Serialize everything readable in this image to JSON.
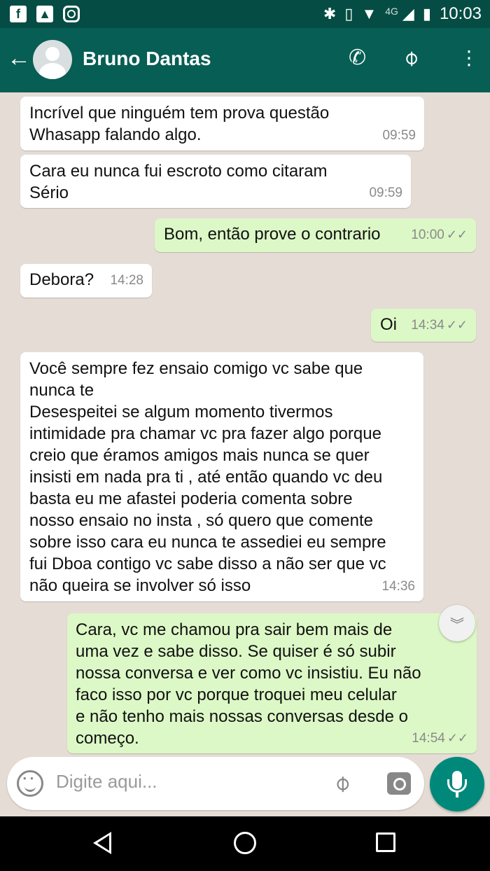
{
  "status_bar": {
    "time": "10:03",
    "network": "4G",
    "icons": [
      "facebook-icon",
      "gallery-icon",
      "instagram-icon",
      "bluetooth-icon",
      "vibrate-icon",
      "wifi-icon",
      "signal-icon",
      "battery-icon"
    ]
  },
  "header": {
    "contact_name": "Bruno Dantas",
    "icons": [
      "back-arrow-icon",
      "avatar",
      "phone-icon",
      "attach-icon",
      "more-icon"
    ]
  },
  "messages": [
    {
      "direction": "in",
      "text": "Incrível que ninguém tem prova questão\nWhasapp falando algo.",
      "time": "09:59"
    },
    {
      "direction": "in",
      "text": "Cara eu nunca fui escroto como citaram\nSério",
      "time": "09:59"
    },
    {
      "direction": "out",
      "text": "Bom, então prove o contrario",
      "time": "10:00",
      "read": "✓✓"
    },
    {
      "direction": "in",
      "text": "Debora?",
      "time": "14:28"
    },
    {
      "direction": "out",
      "text": "Oi",
      "time": "14:34",
      "read": "✓✓"
    },
    {
      "direction": "in",
      "text": "Você sempre fez ensaio comigo vc sabe que\nnunca te\nDesespeitei se algum momento tivermos\nintimidade pra chamar vc pra fazer algo porque\ncreio que éramos amigos mais nunca se quer\ninsisti em nada pra ti , até então quando vc deu\nbasta eu me afastei poderia comenta sobre\nnosso ensaio no insta , só quero que comente\nsobre isso cara eu nunca te assediei eu sempre\nfui Dboa contigo vc sabe disso a não ser que vc\nnão queira se involver só isso",
      "time": "14:36"
    },
    {
      "direction": "out",
      "text": "Cara, vc me chamou pra sair bem mais de\numa vez e sabe disso. Se quiser é só subir\nnossa conversa e ver como vc insistiu. Eu não\nfaco isso por vc porque troquei meu celular\ne não tenho mais nossas conversas desde o\ncomeço.",
      "time": "14:54",
      "read": "✓✓"
    }
  ],
  "composer": {
    "placeholder": "Digite aqui...",
    "icons": [
      "emoji-icon",
      "attach-icon",
      "camera-icon",
      "mic-icon"
    ]
  },
  "colors": {
    "header": "#075e54",
    "status_bar": "#054d44",
    "chat_background": "#e5ddd5",
    "outgoing_bubble": "#dcf8c6",
    "incoming_bubble": "#ffffff",
    "mic_button": "#00897b"
  }
}
